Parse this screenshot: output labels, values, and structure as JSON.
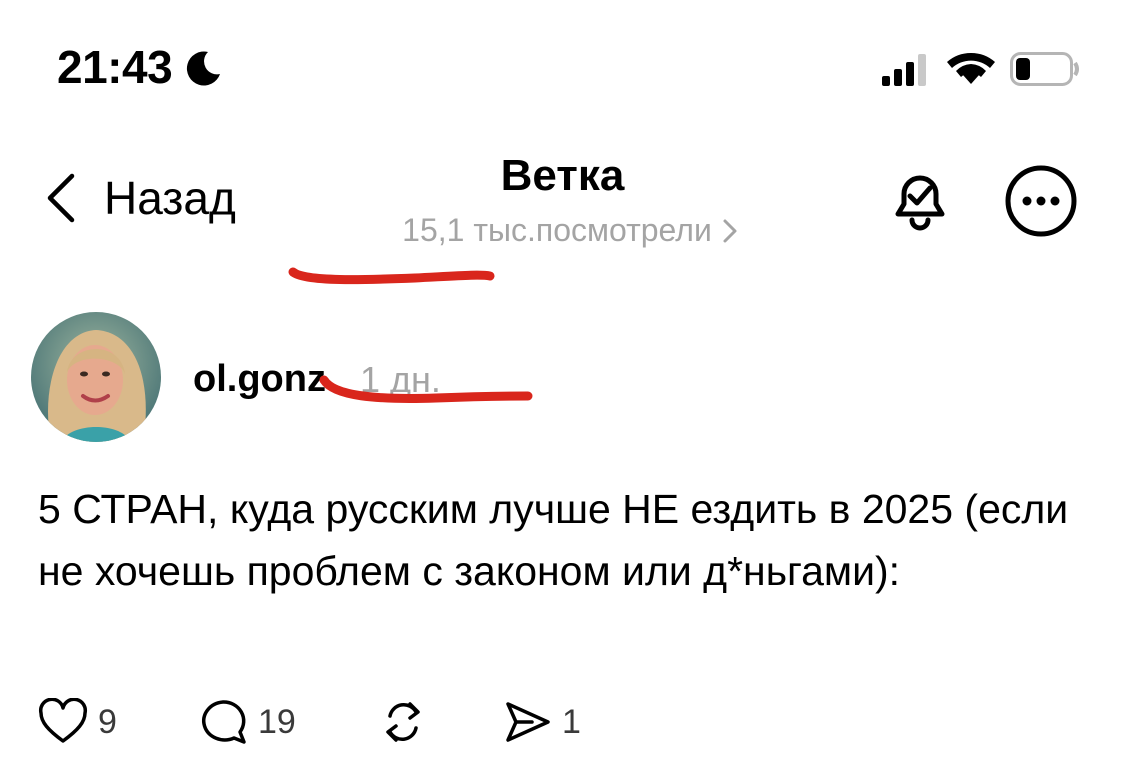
{
  "status_bar": {
    "time": "21:43",
    "focus_icon": "moon-icon",
    "signal_icon": "cellular-signal-icon",
    "wifi_icon": "wifi-icon",
    "battery_icon": "battery-icon",
    "battery_level": 0.25
  },
  "header": {
    "back_label": "Назад",
    "title": "Ветка",
    "views": "15,1 тыс.посмотрели",
    "bell_icon": "bell-check-icon",
    "more_icon": "more-icon"
  },
  "post": {
    "username": "ol.gonz",
    "time_ago": "1 дн.",
    "text": "5 СТРАН, куда русским лучше НЕ ездить в 2025 (если не хочешь проблем с законом или д*ньгами):",
    "actions": {
      "likes": "9",
      "comments": "19",
      "reposts": "",
      "shares": "1"
    }
  },
  "colors": {
    "accent_annotation": "#d9261c",
    "muted_text": "#a4a4a4"
  }
}
